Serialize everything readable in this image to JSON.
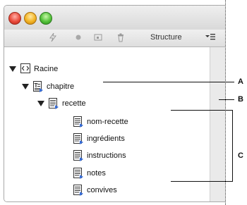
{
  "toolbar": {
    "view_label": "Structure",
    "icons": [
      "lightning-icon",
      "dot-icon",
      "frame-icon",
      "trash-icon",
      "panel-menu-icon"
    ]
  },
  "tree": {
    "root": {
      "label": "Racine"
    },
    "chapitre": {
      "label": "chapitre"
    },
    "recette": {
      "label": "recette"
    },
    "children": [
      {
        "label": "nom-recette"
      },
      {
        "label": "ingrédients"
      },
      {
        "label": "instructions"
      },
      {
        "label": "notes"
      },
      {
        "label": "convives"
      }
    ]
  },
  "callouts": {
    "a": "A",
    "b": "B",
    "c": "C"
  }
}
